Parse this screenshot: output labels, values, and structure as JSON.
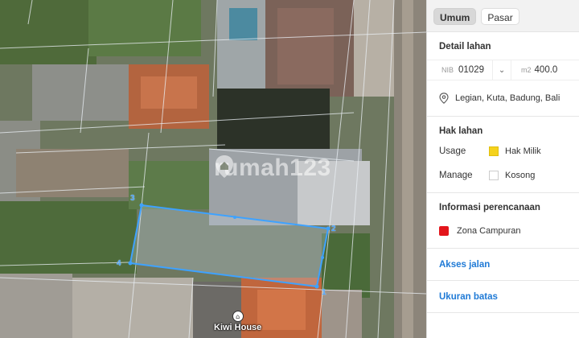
{
  "map": {
    "watermark": "rumah123",
    "poi_label": "Kiwi House",
    "corners": [
      "3",
      "2",
      "4",
      "1"
    ],
    "highlight_color": "#3ea2ff"
  },
  "panel": {
    "tabs": [
      {
        "label": "Umum",
        "active": true
      },
      {
        "label": "Pasar",
        "active": false
      }
    ],
    "detail": {
      "title": "Detail lahan",
      "nib_prefix": "NIB",
      "nib_value": "01029",
      "area_prefix": "m2",
      "area_value": "400.0",
      "location": "Legian, Kuta, Badung, Bali"
    },
    "rights": {
      "title": "Hak lahan",
      "rows": [
        {
          "key": "Usage",
          "value": "Hak Milik",
          "color": "#f5d21c"
        },
        {
          "key": "Manage",
          "value": "Kosong",
          "color": "#ffffff"
        }
      ]
    },
    "planning": {
      "title": "Informasi perencanaan",
      "zone": "Zona Campuran",
      "zone_color": "#e3151b"
    },
    "links": {
      "road_access": "Akses jalan",
      "boundary_size": "Ukuran batas"
    }
  }
}
